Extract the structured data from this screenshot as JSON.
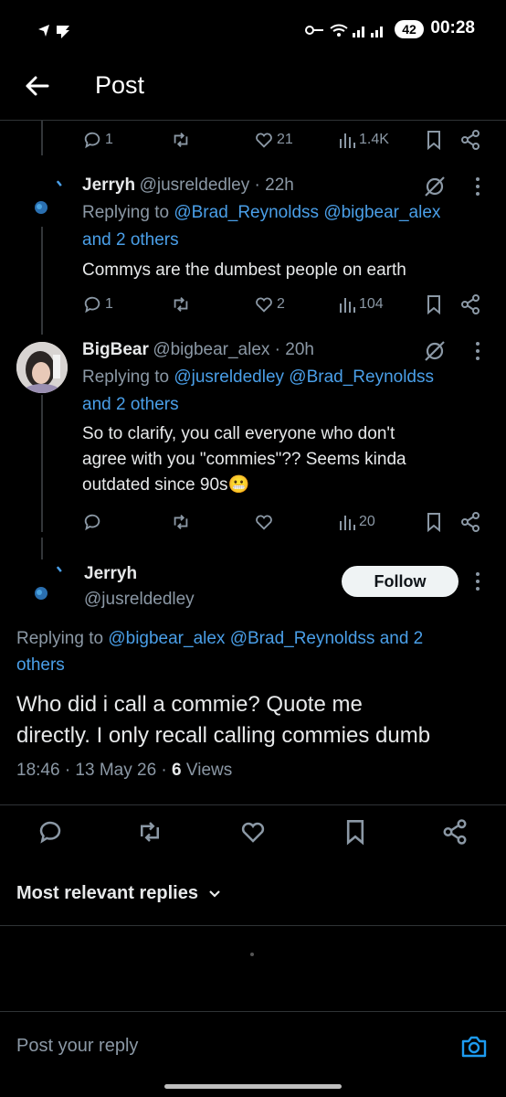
{
  "status": {
    "time": "00:28",
    "battery": "42"
  },
  "header": {
    "title": "Post"
  },
  "top_actions": {
    "replies": "1",
    "reposts": "",
    "likes": "21",
    "views": "1.4K"
  },
  "reply1": {
    "name": "Jerryh",
    "handle": "@jusreldedley · 22h",
    "replying_prefix": "Replying to ",
    "replying_mentions": "@Brad_Reynoldss @bigbear_alex",
    "replying_others": "and 2 others",
    "text": "Commys are the dumbest people on earth",
    "replies": "1",
    "likes": "2",
    "views": "104"
  },
  "reply2": {
    "name": "BigBear",
    "handle": "@bigbear_alex · 20h",
    "replying_prefix": "Replying to ",
    "replying_mentions": "@jusreldedley @Brad_Reynoldss",
    "replying_others": "and 2 others",
    "text_lines": [
      "So to clarify, you call everyone who don't",
      "agree with you \"commies\"?? Seems kinda",
      "outdated since 90s😬"
    ],
    "views": "20"
  },
  "main": {
    "name": "Jerryh",
    "handle": "@jusreldedley",
    "follow_label": "Follow",
    "replying_prefix": "Replying to ",
    "replying_line1": "@bigbear_alex @Brad_Reynoldss and 2",
    "replying_line2": "others",
    "text_lines": [
      "Who did i call a commie? Quote me",
      "directly. I only recall calling commies dumb"
    ],
    "meta_time": "18:46 · 13 May 26 · ",
    "meta_views_count": "6",
    "meta_views_label": " Views"
  },
  "sort": {
    "label": "Most relevant replies"
  },
  "composer": {
    "placeholder": "Post your reply"
  },
  "colors": {
    "accent": "#1d9bf0",
    "mention": "#4a9fe8",
    "muted": "#8b98a5",
    "background": "#000000"
  }
}
